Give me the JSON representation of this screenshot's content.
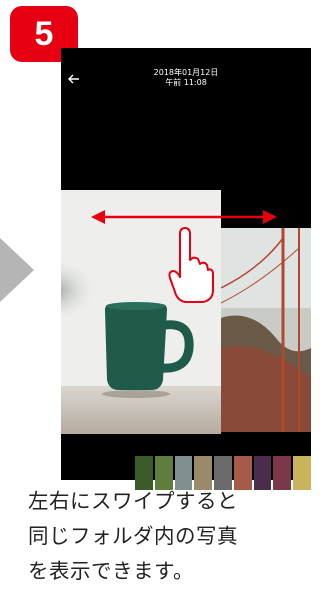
{
  "step": {
    "number": "5",
    "color": "#e60012"
  },
  "header": {
    "date": "2018年01月12日",
    "time": "午前 11:08"
  },
  "icons": {
    "back": "back-arrow-icon",
    "swipe_hint": "swipe-hand-icon",
    "toolbar": [
      "lock-icon",
      "share-icon",
      "play-icon",
      "trash-icon"
    ]
  },
  "thumbnails": [
    "#3b5b2b",
    "#5f7d3c",
    "#7e9190",
    "#9a8a6a",
    "#6b6b6b",
    "#a65a4a",
    "#4a2d4a",
    "#7a3848",
    "#c8b45a"
  ],
  "caption": {
    "line1": "左右にスワイプすると",
    "line2": "同じフォルダ内の写真",
    "line3": "を表示できます。"
  }
}
